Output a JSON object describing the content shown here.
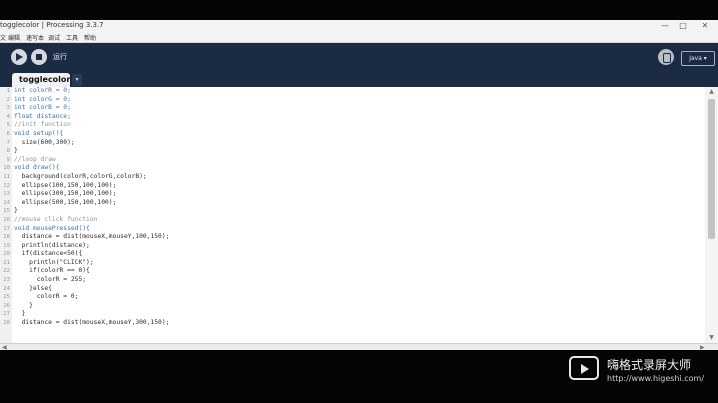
{
  "window": {
    "title": "togglecolor | Processing 3.3.7"
  },
  "menu": {
    "items": [
      "文",
      "编辑",
      "速写本",
      "调试",
      "工具",
      "帮助"
    ]
  },
  "toolbar": {
    "run_icon": "play-icon",
    "stop_icon": "stop-icon",
    "label": "运行",
    "debug_icon": "bug-icon",
    "mode": "Java ▾"
  },
  "tabs": {
    "active": "togglecolor",
    "menu": "▾"
  },
  "editor": {
    "line_numbers": [
      "1",
      "2",
      "3",
      "4",
      "5",
      "6",
      "7",
      "8",
      "9",
      "10",
      "11",
      "12",
      "13",
      "14",
      "15",
      "16",
      "17",
      "18",
      "19",
      "20",
      "21",
      "22",
      "23",
      "24",
      "25",
      "26",
      "27",
      "28"
    ],
    "lines": [
      "int colorR = 0;",
      "int colorG = 0;",
      "int colorB = 0;",
      "float distance;",
      "//init function",
      "void setup(){",
      "  size(600,300);",
      "}",
      "//loop draw",
      "void draw(){",
      "  background(colorR,colorG,colorB);",
      "  ellipse(100,150,100,100);",
      "  ellipse(300,150,100,100);",
      "  ellipse(500,150,100,100);",
      "}",
      "//mouse click function",
      "void mousePressed(){",
      "  distance = dist(mouseX,mouseY,100,150);",
      "  println(distance);",
      "  if(distance<50){",
      "    println(\"CLICK\");",
      "    if(colorR == 0){",
      "      colorR = 255;",
      "    }else{",
      "      colorR = 0;",
      "    }",
      "  }",
      "  distance = dist(mouseX,mouseY,300,150);"
    ]
  },
  "watermark": {
    "title": "嗨格式录屏大师",
    "url": "http://www.higeshi.com/"
  },
  "colors": {
    "toolbar_bg": "#1b2b44",
    "keyword": "#3a6fb0",
    "comment": "#8a96a3"
  }
}
